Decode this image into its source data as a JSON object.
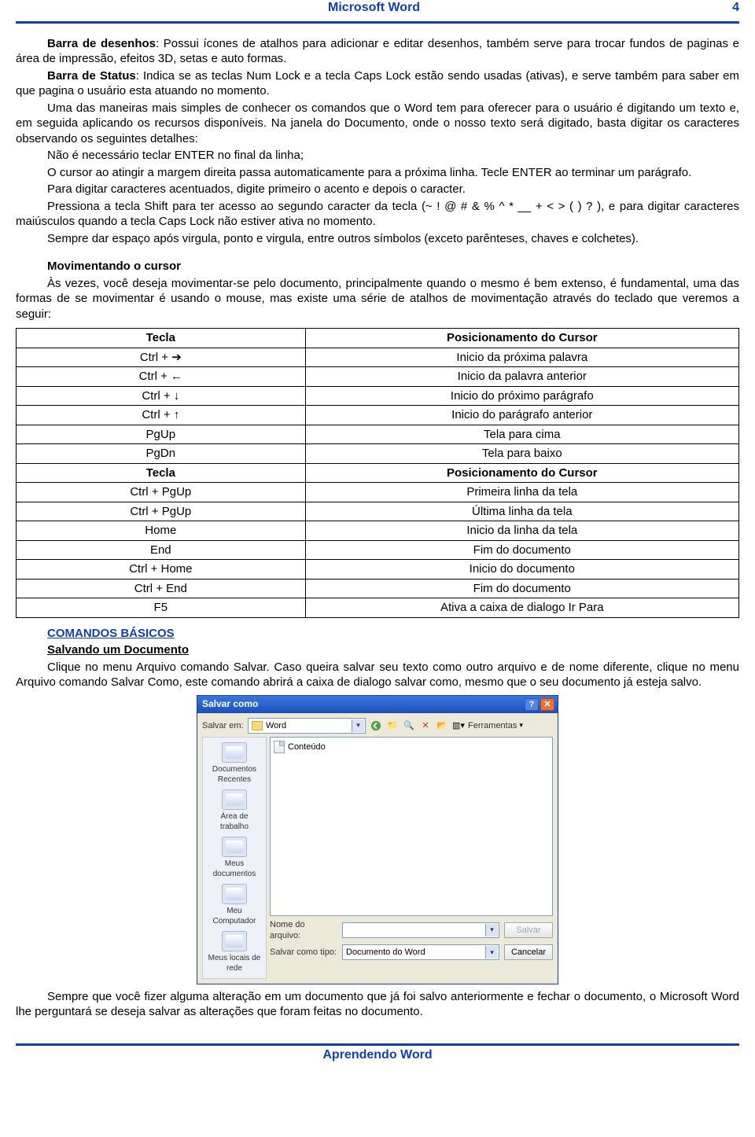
{
  "header": {
    "title": "Microsoft Word",
    "page_no": "4"
  },
  "footer": {
    "text": "Aprendendo Word"
  },
  "body": {
    "p1_bold": "Barra de desenhos",
    "p1_rest": ": Possui ícones de atalhos para adicionar e editar desenhos, também serve para trocar fundos de paginas e área de impressão, efeitos 3D, setas e auto formas.",
    "p2_bold": "Barra de Status",
    "p2_rest": ": Indica se as teclas Num Lock e a tecla Caps Lock estão sendo usadas (ativas), e serve também para saber em que pagina o usuário esta atuando no momento.",
    "p3": "Uma das maneiras mais simples de conhecer os comandos que o Word tem para oferecer para o usuário é digitando um texto e, em seguida aplicando os recursos disponíveis. Na janela do Documento, onde o nosso texto será digitado, basta digitar os caracteres observando os seguintes detalhes:",
    "p4": "Não é necessário teclar ENTER no final da linha;",
    "p5": "O cursor ao atingir a margem direita passa automaticamente para a próxima linha. Tecle ENTER ao terminar um parágrafo.",
    "p6": "Para digitar caracteres acentuados, digite primeiro o acento e depois o caracter.",
    "p7": "Pressiona a tecla Shift para ter acesso ao segundo caracter da tecla (~ ! @ # & % ^ * __ + < > ( ) ? ), e para digitar caracteres maiúsculos quando a tecla Caps Lock não estiver ativa no momento.",
    "p8": "Sempre dar espaço após virgula, ponto e virgula, entre outros símbolos (exceto parênteses, chaves e colchetes).",
    "mov_heading": "Movimentando o cursor",
    "mov_para": "Às vezes, você deseja movimentar-se pelo documento, principalmente quando o mesmo é bem extenso, é fundamental, uma das formas de se movimentar é usando o mouse, mas existe uma série de atalhos de movimentação através do teclado que veremos a seguir:",
    "table": [
      {
        "k": "Tecla",
        "v": "Posicionamento do Cursor",
        "hdr": true
      },
      {
        "k": "Ctrl + ➔",
        "v": "Inicio da próxima palavra"
      },
      {
        "k": "Ctrl + ←",
        "v": "Inicio da palavra anterior"
      },
      {
        "k": "Ctrl + ↓",
        "v": "Inicio do próximo parágrafo"
      },
      {
        "k": "Ctrl + ↑",
        "v": "Inicio do parágrafo anterior"
      },
      {
        "k": "PgUp",
        "v": "Tela para cima"
      },
      {
        "k": "PgDn",
        "v": "Tela para baixo"
      },
      {
        "k": "Tecla",
        "v": "Posicionamento do Cursor",
        "hdr": true
      },
      {
        "k": "Ctrl + PgUp",
        "v": "Primeira linha da tela"
      },
      {
        "k": "Ctrl + PgUp",
        "v": "Última linha da tela"
      },
      {
        "k": "Home",
        "v": "Inicio da linha da tela"
      },
      {
        "k": "End",
        "v": "Fim do documento"
      },
      {
        "k": "Ctrl + Home",
        "v": "Inicio do documento"
      },
      {
        "k": "Ctrl + End",
        "v": "Fim do documento"
      },
      {
        "k": "F5",
        "v": "Ativa a caixa de dialogo Ir Para"
      }
    ],
    "sec2": "COMANDOS BÁSICOS",
    "sec2_sub": "Salvando um Documento",
    "sec2_para": "Clique no menu Arquivo comando Salvar. Caso queira salvar seu texto como outro arquivo e de nome diferente, clique no menu Arquivo comando Salvar Como, este comando abrirá a caixa de dialogo salvar como, mesmo que o seu documento já esteja salvo.",
    "after_dlg": "Sempre que você fizer alguma alteração em um documento que já foi salvo anteriormente e fechar o documento, o Microsoft Word lhe perguntará se deseja salvar as alterações que foram feitas no documento."
  },
  "dialog": {
    "title": "Salvar como",
    "help": "?",
    "close": "✕",
    "save_in_label": "Salvar em:",
    "folder_name": "Word",
    "tools_label": "Ferramentas",
    "file_item": "Conteúdo",
    "places": [
      "Documentos Recentes",
      "Área de trabalho",
      "Meus documentos",
      "Meu Computador",
      "Meus locais de rede"
    ],
    "name_label": "Nome do arquivo:",
    "name_value": "",
    "type_label": "Salvar como tipo:",
    "type_value": "Documento do Word",
    "btn_save": "Salvar",
    "btn_cancel": "Cancelar"
  }
}
